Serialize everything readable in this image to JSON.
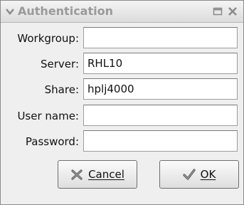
{
  "window": {
    "title": "Authentication",
    "icons": {
      "menu": "chevron-down-icon",
      "maximize": "maximize-icon",
      "close": "close-icon"
    }
  },
  "form": {
    "fields": [
      {
        "label": "Workgroup:",
        "value": ""
      },
      {
        "label": "Server:",
        "value": "RHL10"
      },
      {
        "label": "Share:",
        "value": "hplj4000"
      },
      {
        "label": "User name:",
        "value": ""
      },
      {
        "label": "Password:",
        "value": ""
      }
    ]
  },
  "buttons": {
    "cancel": {
      "label": "Cancel",
      "icon": "cancel-x-icon"
    },
    "ok": {
      "label": "OK",
      "icon": "checkmark-icon"
    }
  }
}
